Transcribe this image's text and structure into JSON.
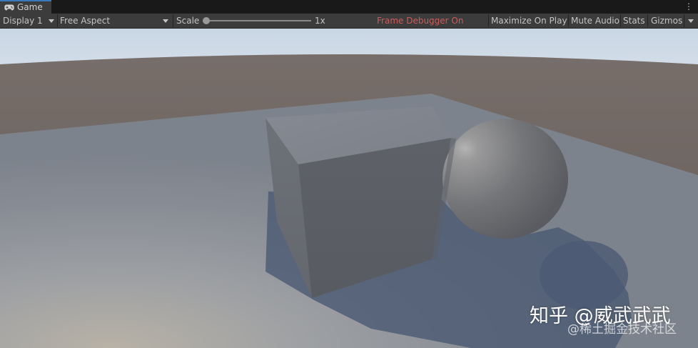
{
  "window": {
    "tab_label": "Game",
    "tab_icon": "gamepad-icon",
    "menu_icon": "kebab-menu-icon"
  },
  "toolbar": {
    "display": "Display 1",
    "aspect": "Free Aspect",
    "scale_label": "Scale",
    "scale_value": "1x",
    "frame_debugger": "Frame Debugger On",
    "maximize_on_play": "Maximize On Play",
    "mute_audio": "Mute Audio",
    "stats": "Stats",
    "gizmos": "Gizmos"
  },
  "colors": {
    "tab_accent": "#3a79bb",
    "frame_debugger_text": "#cd5b5b",
    "toolbar_bg": "#3c3c3c"
  },
  "watermark": {
    "main": "知乎 @威武武武",
    "sub": "@稀土掘金技术社区"
  }
}
